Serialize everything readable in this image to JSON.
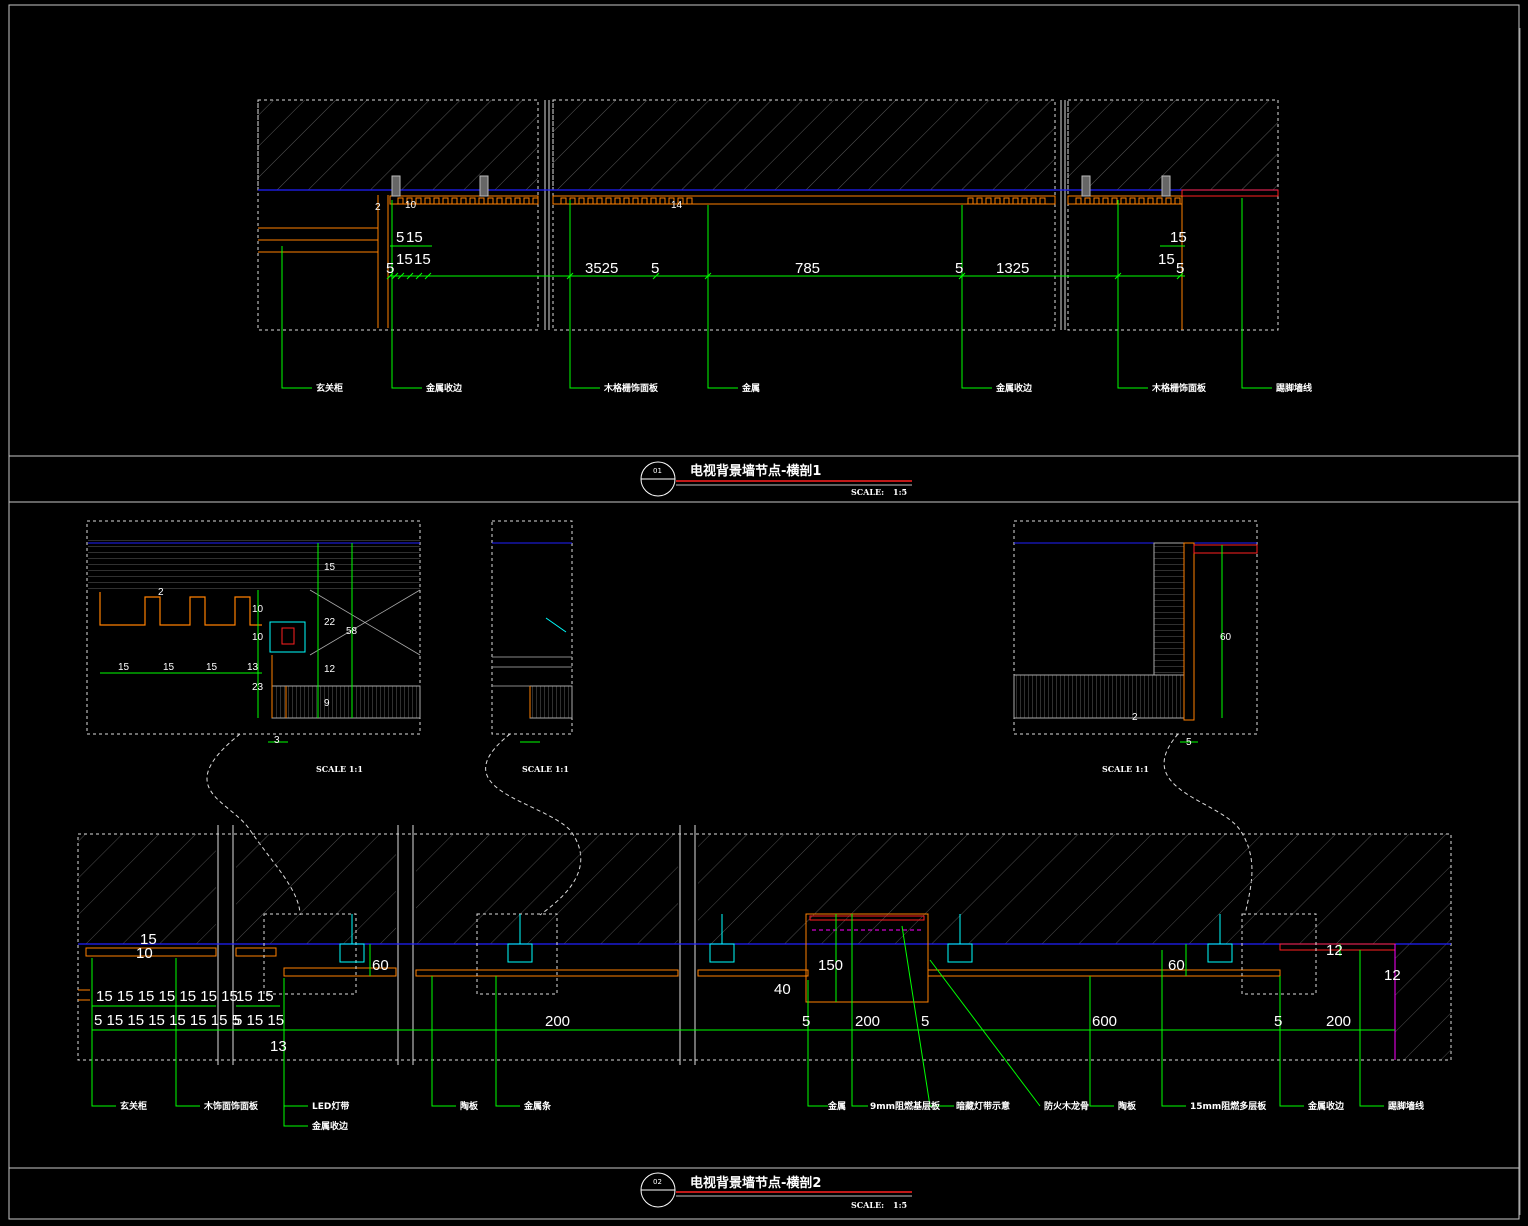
{
  "colors": {
    "background": "#000000",
    "frame": "#c8c8c8",
    "leader": "#00ff00",
    "finish_line": "#2020ff",
    "panel": "#ff8000",
    "metal": "#ff2020",
    "concrete": "#6e6e6e"
  },
  "section1": {
    "number": "01",
    "title": "电视背景墙节点-横剖1",
    "scale_label": "SCALE:",
    "scale_value": "1:5",
    "dims_small": [
      "5",
      "15",
      "15",
      "15",
      "15",
      "10",
      "2",
      "14",
      "15",
      "15",
      "5"
    ],
    "dims_main": [
      {
        "text": "5"
      },
      {
        "text": "3525"
      },
      {
        "text": "5"
      },
      {
        "text": "785"
      },
      {
        "text": "5"
      },
      {
        "text": "1325"
      }
    ],
    "labels": [
      "玄关柜",
      "金属收边",
      "木格栅饰面板",
      "金属",
      "金属收边",
      "木格栅饰面板",
      "踢脚墙线"
    ]
  },
  "section2": {
    "number": "02",
    "title": "电视背景墙节点-横剖2",
    "scale_label": "SCALE:",
    "scale_value": "1:5",
    "detail_scale": "SCALE 1:1",
    "detail1_dims": [
      "15",
      "15",
      "15",
      "13",
      "10",
      "10",
      "23",
      "22",
      "12",
      "9",
      "58",
      "15",
      "2",
      "3"
    ],
    "detail3_dims": [
      "60",
      "2",
      "5"
    ],
    "dims_main": [
      {
        "text": "15 15 15 15 15 15 15"
      },
      {
        "text": "5 15 15 15 15 15 15 5"
      },
      {
        "text": "15 15"
      },
      {
        "text": "5 15 15"
      },
      {
        "text": "13"
      },
      {
        "text": "200"
      },
      {
        "text": "5"
      },
      {
        "text": "200"
      },
      {
        "text": "5"
      },
      {
        "text": "600"
      },
      {
        "text": "5"
      },
      {
        "text": "200"
      },
      {
        "text": "150"
      },
      {
        "text": "40"
      },
      {
        "text": "60"
      },
      {
        "text": "60"
      },
      {
        "text": "12"
      },
      {
        "text": "12"
      },
      {
        "text": "10"
      },
      {
        "text": "15"
      }
    ],
    "labels": [
      "玄关柜",
      "木饰面饰面板",
      "LED灯带",
      "金属收边",
      "陶板",
      "金属条",
      "金属",
      "9mm阻燃基层板",
      "暗藏灯带示意",
      "防火木龙骨",
      "陶板",
      "15mm阻燃多层板",
      "金属收边",
      "踢脚墙线"
    ]
  }
}
